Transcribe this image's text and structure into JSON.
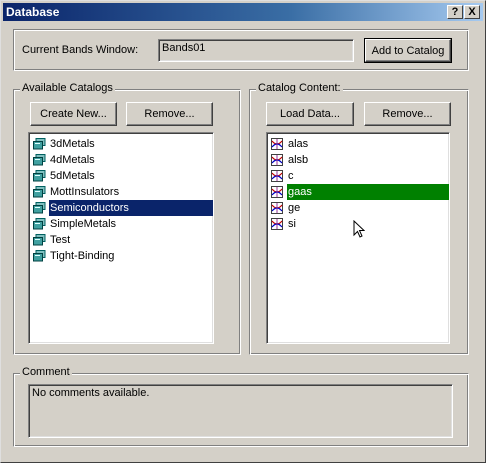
{
  "window": {
    "title": "Database",
    "help_label": "?",
    "close_label": "X"
  },
  "current": {
    "label": "Current Bands Window:",
    "value": "Bands01",
    "add_button": "Add to Catalog"
  },
  "catalogs": {
    "group_label": "Available Catalogs",
    "create_button": "Create New...",
    "remove_button": "Remove...",
    "selected": "Semiconductors",
    "items": [
      {
        "label": "3dMetals",
        "icon": "catalog-db-icon"
      },
      {
        "label": "4dMetals",
        "icon": "catalog-db-icon"
      },
      {
        "label": "5dMetals",
        "icon": "catalog-db-icon"
      },
      {
        "label": "MottInsulators",
        "icon": "catalog-db-icon"
      },
      {
        "label": "Semiconductors",
        "icon": "catalog-db-icon"
      },
      {
        "label": "SimpleMetals",
        "icon": "catalog-db-icon"
      },
      {
        "label": "Test",
        "icon": "catalog-db-icon"
      },
      {
        "label": "Tight-Binding",
        "icon": "catalog-db-icon"
      }
    ]
  },
  "content": {
    "group_label": "Catalog Content:",
    "load_button": "Load Data...",
    "remove_button": "Remove...",
    "selected": "gaas",
    "items": [
      {
        "label": "alas",
        "icon": "band-structure-icon"
      },
      {
        "label": "alsb",
        "icon": "band-structure-icon"
      },
      {
        "label": "c",
        "icon": "band-structure-icon"
      },
      {
        "label": "gaas",
        "icon": "band-structure-icon"
      },
      {
        "label": "ge",
        "icon": "band-structure-icon"
      },
      {
        "label": "si",
        "icon": "band-structure-icon"
      }
    ]
  },
  "comment": {
    "group_label": "Comment",
    "text": "No comments available."
  },
  "colors": {
    "title_gradient_start": "#0a246a",
    "selection_blue": "#0a246a",
    "selection_green": "#008000",
    "face": "#d4d0c8"
  }
}
